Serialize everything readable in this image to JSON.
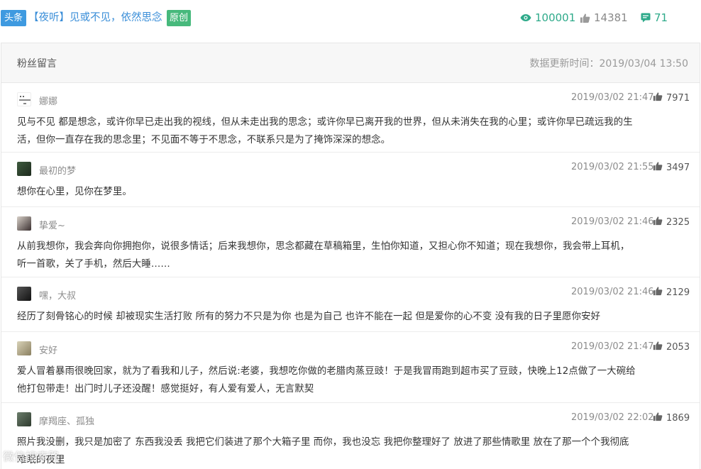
{
  "article": {
    "tag": "头条",
    "title": "【夜听】见或不见，依然思念",
    "original_tag": "原创",
    "views": "100001",
    "likes": "14381",
    "comments": "71"
  },
  "panel": {
    "title": "粉丝留言",
    "update_time": "数据更新时间：2019/03/04 13:50"
  },
  "comments": [
    {
      "name": "娜娜",
      "time": "2019/03/02 21:47",
      "likes": "7971",
      "line1": "见与不见 都是想念，或许你早已走出我的视线，但从未走出我的思念；或许你早已离开我的世界，但从未消失在我的心里；或许你早已疏远我的生",
      "line2": "活，但你一直存在我的思念里；不见面不等于不思念，不联系只是为了掩饰深深的想念。"
    },
    {
      "name": "最初的梦",
      "time": "2019/03/02 21:55",
      "likes": "3497",
      "line1": "想你在心里，见你在梦里。",
      "line2": ""
    },
    {
      "name": "挚爱~",
      "time": "2019/03/02 21:46",
      "likes": "2325",
      "line1": "从前我想你，我会奔向你拥抱你，说很多情话；后来我想你，思念都藏在草稿箱里，生怕你知道，又担心你不知道；现在我想你，我会带上耳机，",
      "line2": "听一首歌，关了手机，然后大睡……"
    },
    {
      "name": "嘿，大叔",
      "time": "2019/03/02 21:46",
      "likes": "2129",
      "line1": "经历了刻骨铭心的时候 却被现实生活打败 所有的努力不只是为你 也是为自己 也许不能在一起 但是爱你的心不变 没有我的日子里愿你安好",
      "line2": ""
    },
    {
      "name": "安好",
      "time": "2019/03/02 21:47",
      "likes": "2053",
      "line1": "爱人冒着暴雨很晚回家，就为了看我和儿子，然后说:老婆，我想吃你做的老腊肉蒸豆豉！于是我冒雨跑到超市买了豆豉，快晚上12点做了一大碗给",
      "line2": "他打包带走！出门时儿子还没醒！感觉挺好，有人爱有爱人，无言默契"
    },
    {
      "name": "摩羯座、孤独",
      "time": "2019/03/02 22:02",
      "likes": "1869",
      "line1": "照片我没删，我只是加密了 东西我没丢 我把它们装进了那个大箱子里 而你，我也没忘 我把你整理好了 放进了那些情歌里 放在了那一个个我彻底",
      "line2": "难眠的夜里"
    }
  ],
  "watermark": "微信搜索路",
  "colors": {
    "accent_blue": "#3f9ae0",
    "accent_green": "#47b97c",
    "stat_green": "#2eaa8a"
  }
}
